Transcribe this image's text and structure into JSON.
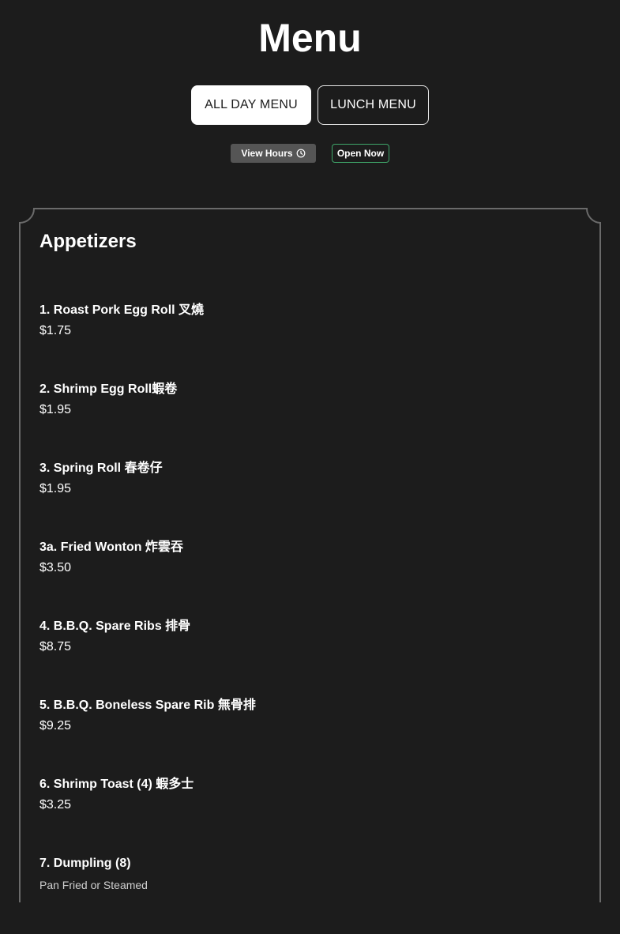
{
  "page": {
    "title": "Menu"
  },
  "tabs": [
    {
      "label": "ALL DAY MENU",
      "active": true
    },
    {
      "label": "LUNCH MENU",
      "active": false
    }
  ],
  "hours": {
    "button_label": "View Hours",
    "status": "Open Now"
  },
  "section": {
    "title": "Appetizers",
    "items": [
      {
        "name": "1. Roast Pork Egg Roll 叉燒",
        "price": "$1.75"
      },
      {
        "name": "2. Shrimp Egg Roll蝦卷",
        "price": "$1.95"
      },
      {
        "name": "3. Spring Roll 春卷仔",
        "price": "$1.95"
      },
      {
        "name": "3a. Fried Wonton 炸雲吞",
        "price": "$3.50"
      },
      {
        "name": "4. B.B.Q. Spare Ribs 排骨",
        "price": "$8.75"
      },
      {
        "name": "5. B.B.Q. Boneless Spare Rib 無骨排",
        "price": "$9.25"
      },
      {
        "name": "6. Shrimp Toast (4) 蝦多士",
        "price": "$3.25"
      },
      {
        "name": "7. Dumpling (8)",
        "description": "Pan Fried or Steamed"
      }
    ]
  },
  "colors": {
    "background": "#1c1c1c",
    "text": "#ffffff",
    "open_badge_border": "#3fa66a",
    "hours_button_bg": "#555555"
  },
  "icons": {
    "hours": "clock-icon"
  }
}
